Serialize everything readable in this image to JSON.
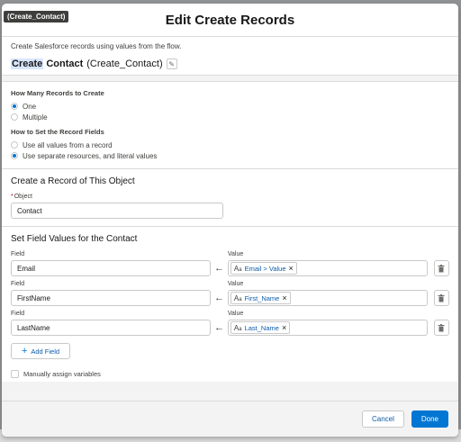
{
  "tooltip": "(Create_Contact)",
  "modal": {
    "title": "Edit Create Records"
  },
  "element": {
    "description": "Create Salesforce records using values from the flow.",
    "type_label": "Create",
    "name_label": "Contact",
    "api_name": "(Create_Contact)"
  },
  "record_options": {
    "how_many_label": "How Many Records to Create",
    "how_many_options": [
      {
        "label": "One",
        "checked": true
      },
      {
        "label": "Multiple",
        "checked": false
      }
    ],
    "how_set_label": "How to Set the Record Fields",
    "how_set_options": [
      {
        "label": "Use all values from a record",
        "checked": false
      },
      {
        "label": "Use separate resources, and literal values",
        "checked": true
      }
    ]
  },
  "object_section": {
    "heading": "Create a Record of This Object",
    "object_label": "Object",
    "required_marker": "*",
    "object_value": "Contact"
  },
  "field_values": {
    "heading": "Set Field Values for the Contact",
    "field_col_label": "Field",
    "value_col_label": "Value",
    "rows": [
      {
        "field": "Email",
        "value": "Email > Value"
      },
      {
        "field": "FirstName",
        "value": "First_Name"
      },
      {
        "field": "LastName",
        "value": "Last_Name"
      }
    ],
    "add_field_label": "Add Field",
    "manual_assign_label": "Manually assign variables"
  },
  "footer": {
    "cancel_label": "Cancel",
    "done_label": "Done"
  },
  "colors": {
    "brand": "#0176d3",
    "link": "#0b5cab",
    "highlight": "#d8e6fe"
  },
  "icons": {
    "pencil": "pencil-icon",
    "arrow": "left-arrow-icon",
    "text_resource": "text-resource-icon",
    "remove": "close-icon",
    "delete": "trash-icon",
    "add": "plus-icon"
  }
}
